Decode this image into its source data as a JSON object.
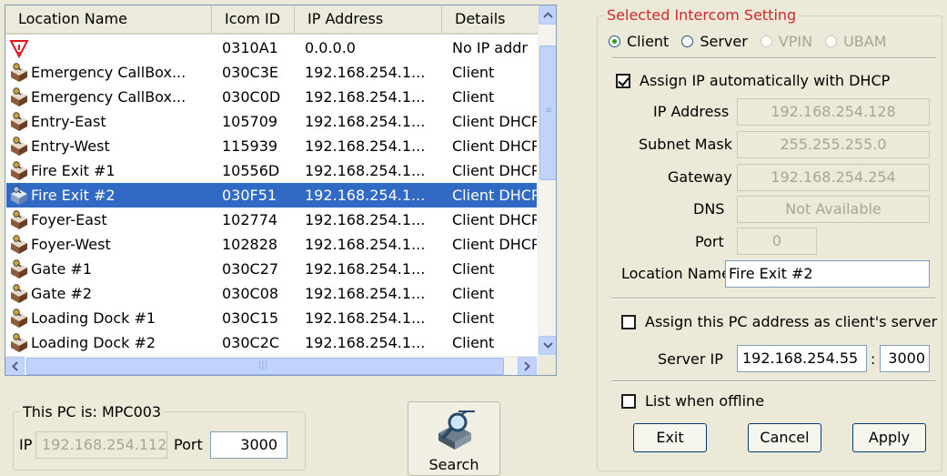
{
  "list": {
    "columns": [
      "Location Name",
      "Icom ID",
      "IP Address",
      "Details"
    ],
    "rows": [
      {
        "icon": "warning-triangle-icon",
        "name": "",
        "id": "0310A1",
        "ip": "0.0.0.0",
        "details": "No IP addr",
        "selected": false
      },
      {
        "icon": "intercom-icon",
        "name": "Emergency CallBox...",
        "id": "030C3E",
        "ip": "192.168.254.1...",
        "details": "Client",
        "selected": false
      },
      {
        "icon": "intercom-icon",
        "name": "Emergency CallBox...",
        "id": "030C0D",
        "ip": "192.168.254.1...",
        "details": "Client",
        "selected": false
      },
      {
        "icon": "intercom-icon",
        "name": "Entry-East",
        "id": "105709",
        "ip": "192.168.254.1...",
        "details": "Client DHCP",
        "selected": false
      },
      {
        "icon": "intercom-icon",
        "name": "Entry-West",
        "id": "115939",
        "ip": "192.168.254.1...",
        "details": "Client DHCP",
        "selected": false
      },
      {
        "icon": "intercom-icon",
        "name": "Fire Exit #1",
        "id": "10556D",
        "ip": "192.168.254.1...",
        "details": "Client DHCP",
        "selected": false
      },
      {
        "icon": "intercom-selected-icon",
        "name": "Fire Exit #2",
        "id": "030F51",
        "ip": "192.168.254.1...",
        "details": "Client DHCP",
        "selected": true
      },
      {
        "icon": "intercom-icon",
        "name": "Foyer-East",
        "id": "102774",
        "ip": "192.168.254.1...",
        "details": "Client DHCP",
        "selected": false
      },
      {
        "icon": "intercom-icon",
        "name": "Foyer-West",
        "id": "102828",
        "ip": "192.168.254.1...",
        "details": "Client DHCP",
        "selected": false
      },
      {
        "icon": "intercom-icon",
        "name": "Gate #1",
        "id": "030C27",
        "ip": "192.168.254.1...",
        "details": "Client",
        "selected": false
      },
      {
        "icon": "intercom-icon",
        "name": "Gate #2",
        "id": "030C08",
        "ip": "192.168.254.1...",
        "details": "Client",
        "selected": false
      },
      {
        "icon": "intercom-icon",
        "name": "Loading Dock #1",
        "id": "030C15",
        "ip": "192.168.254.1...",
        "details": "Client",
        "selected": false
      },
      {
        "icon": "intercom-icon",
        "name": "Loading Dock #2",
        "id": "030C2C",
        "ip": "192.168.254.1...",
        "details": "Client",
        "selected": false
      }
    ]
  },
  "this_pc": {
    "title": "This PC is: MPC003",
    "ip_label": "IP",
    "ip_value": "192.168.254.112",
    "port_label": "Port",
    "port_value": "3000"
  },
  "search": {
    "label": "Search",
    "icon": "search-magnifier-icon"
  },
  "settings": {
    "title": "Selected Intercom Setting",
    "modes": [
      {
        "label": "Client",
        "checked": true,
        "enabled": true
      },
      {
        "label": "Server",
        "checked": false,
        "enabled": true
      },
      {
        "label": "VPIN",
        "checked": false,
        "enabled": false
      },
      {
        "label": "UBAM",
        "checked": false,
        "enabled": false
      }
    ],
    "dhcp_label": "Assign IP automatically with  DHCP",
    "dhcp_checked": true,
    "ip_label": "IP Address",
    "ip_value": "192.168.254.128",
    "subnet_label": "Subnet Mask",
    "subnet_value": "255.255.255.0",
    "gateway_label": "Gateway",
    "gateway_value": "192.168.254.254",
    "dns_label": "DNS",
    "dns_value": "Not Available",
    "port_label": "Port",
    "port_value": "0",
    "location_label": "Location Name",
    "location_value": "Fire Exit #2",
    "assign_server_label": "Assign this PC address as client's server",
    "assign_server_checked": false,
    "server_ip_label": "Server IP",
    "server_ip_value": "192.168.254.55",
    "server_sep": ":",
    "server_port_value": "3000",
    "offline_label": "List when offline",
    "offline_checked": false,
    "exit_label": "Exit",
    "cancel_label": "Cancel",
    "apply_label": "Apply"
  },
  "colors": {
    "selection": "#316ac5",
    "group_title": "#d0282a",
    "scroll": "#c1d3fb",
    "face": "#ece9d8"
  }
}
